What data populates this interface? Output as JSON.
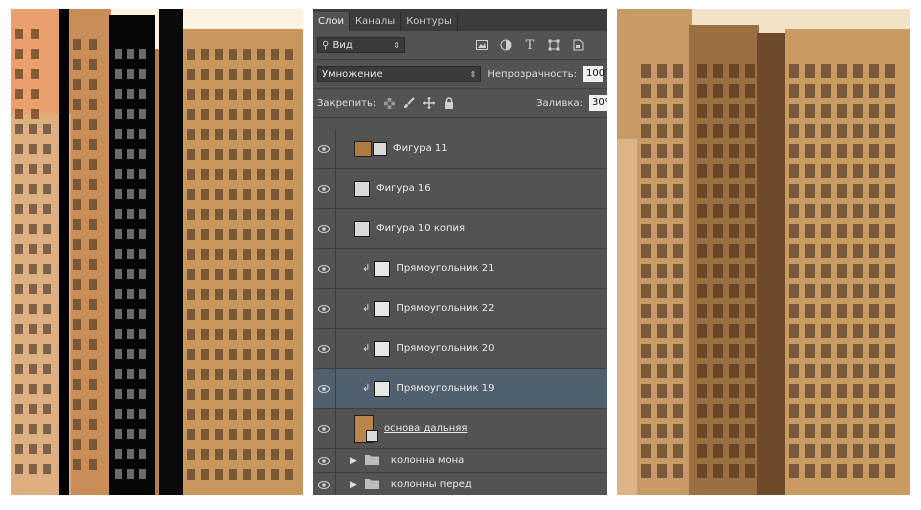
{
  "tabs": [
    "Слои",
    "Каналы",
    "Контуры"
  ],
  "filter": {
    "value": "Вид"
  },
  "filter_icons": [
    "image-filter-icon",
    "adjustment-filter-icon",
    "type-filter-icon",
    "shape-filter-icon",
    "smart-object-filter-icon"
  ],
  "blend": {
    "mode": "Умножение",
    "opacity_label": "Непрозрачность:",
    "opacity_value": "100"
  },
  "lock": {
    "label": "Закрепить:",
    "fill_label": "Заливка:",
    "fill_value": "30%"
  },
  "layers": [
    {
      "name": "Фигура 11",
      "type": "shape-filled",
      "selected": false
    },
    {
      "name": "Фигура 16",
      "type": "shape",
      "selected": false
    },
    {
      "name": "Фигура 10 копия",
      "type": "shape",
      "selected": false
    },
    {
      "name": "Прямоугольник 21",
      "type": "clip",
      "selected": false
    },
    {
      "name": "Прямоугольник 22",
      "type": "clip",
      "selected": false
    },
    {
      "name": "Прямоугольник 20",
      "type": "clip",
      "selected": false
    },
    {
      "name": "Прямоугольник 19",
      "type": "clip",
      "selected": true
    },
    {
      "name": "основа дальняя",
      "type": "base",
      "selected": false
    }
  ],
  "groups": [
    "колонна мона",
    "колонны перед"
  ],
  "colors": {
    "panel": "#535353",
    "dark": "#3c3c3c",
    "selected": "#51606f",
    "building": "#c8965a"
  }
}
